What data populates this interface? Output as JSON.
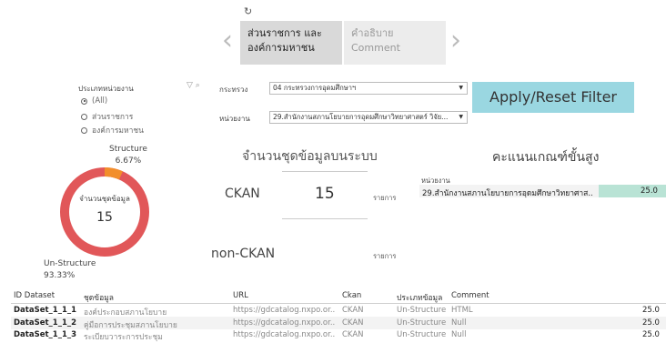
{
  "nav": {
    "refresh_icon": "↻",
    "prev_icon": "‹",
    "next_icon": "›",
    "tabs": [
      {
        "line1": "ส่วนราชการ และ",
        "line2": "องค์การมหาชน"
      },
      {
        "line1": "คำอธิบาย",
        "line2": "Comment"
      }
    ]
  },
  "filters": {
    "agency_type_title": "ประเภทหน่วยงาน",
    "agency_type_options": [
      "(All)",
      "ส่วนราชการ",
      "องค์การมหาชน"
    ],
    "agency_type_selected": "(All)",
    "ministry_label": "กระทรวง",
    "ministry_value": "04 กระทรวงการอุดมศึกษาฯ",
    "unit_label": "หน่วยงาน",
    "unit_value": "29.สำนักงานสภานโยบายการอุดมศึกษาวิทยาศาสตร์ วิจัย..."
  },
  "apply_button": "Apply/Reset Filter",
  "donut": {
    "center_label": "จำนวนชุดข้อมูล",
    "center_value": "15",
    "structure_label": "Structure",
    "structure_pct": "6.67%",
    "unstructure_label": "Un-Structure",
    "unstructure_pct": "93.33%",
    "structure_fraction": 0.0667,
    "colors": {
      "structure": "#f28e2b",
      "unstructure": "#e15759"
    }
  },
  "kpi": {
    "title": "จำนวนชุดข้อมูลบนระบบ",
    "ckan_label": "CKAN",
    "ckan_value": "15",
    "ckan_unit": "รายการ",
    "nonckan_label": "non-CKAN",
    "nonckan_unit": "รายการ"
  },
  "score": {
    "title": "คะแนนเกณฑ์ขั้นสูง",
    "column_label": "หน่วยงาน",
    "row_name": "29.สำนักงานสภานโยบายการอุดมศึกษาวิทยาศาส..",
    "row_value": "25.0"
  },
  "table": {
    "headers": [
      "ID Dataset",
      "ชุดข้อมูล",
      "URL",
      "Ckan",
      "ประเภทข้อมูล",
      "Comment"
    ],
    "rows": [
      {
        "id": "DataSet_1_1_1",
        "name": "องค์ประกอบสภานโยบาย",
        "url": "https://gdcatalog.nxpo.or..",
        "ckan": "CKAN",
        "type": "Un-Structure",
        "comment": "HTML",
        "score": "25.0"
      },
      {
        "id": "DataSet_1_1_2",
        "name": "คู่มือการประชุมสภานโยบาย",
        "url": "https://gdcatalog.nxpo.or..",
        "ckan": "CKAN",
        "type": "Un-Structure",
        "comment": "Null",
        "score": "25.0"
      },
      {
        "id": "DataSet_1_1_3",
        "name": "ระเบียบวาระการประชุม",
        "url": "https://gdcatalog.nxpo.or..",
        "ckan": "CKAN",
        "type": "Un-Structure",
        "comment": "Null",
        "score": "25.0"
      }
    ]
  }
}
